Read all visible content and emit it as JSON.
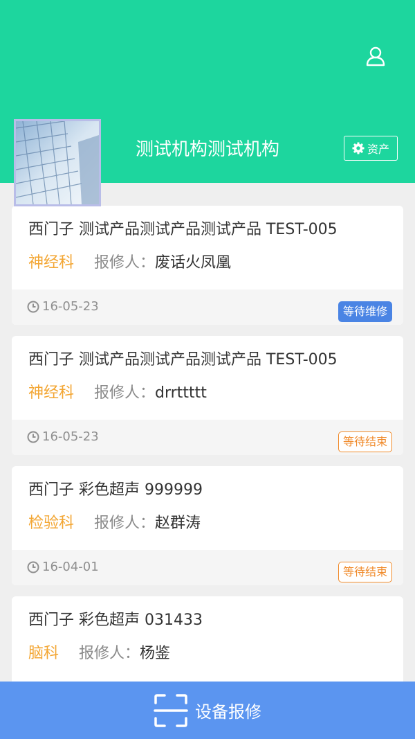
{
  "header": {
    "org_name": "测试机构测试机构",
    "asset_label": "资产",
    "user_icon": "user-icon",
    "settings_icon": "gear-icon"
  },
  "colors": {
    "header_bg": "#1dd69e",
    "department": "#f3a633",
    "badge_repair": "#4a84e4",
    "badge_end": "#f08a2a",
    "bottom_bar": "#5b95f0"
  },
  "orders": [
    {
      "title": "西门子 测试产品测试产品测试产品 TEST-005",
      "department": "神经科",
      "reporter_label": "报修人：",
      "reporter": "废话火凤凰",
      "date": "16-05-23",
      "status": "等待维修"
    },
    {
      "title": "西门子 测试产品测试产品测试产品 TEST-005",
      "department": "神经科",
      "reporter_label": "报修人：",
      "reporter": "drrttttt",
      "date": "16-05-23",
      "status": "等待结束"
    },
    {
      "title": "西门子 彩色超声 999999",
      "department": "检验科",
      "reporter_label": "报修人：",
      "reporter": "赵群涛",
      "date": "16-04-01",
      "status": "等待结束"
    },
    {
      "title": "西门子 彩色超声 031433",
      "department": "脑科",
      "reporter_label": "报修人：",
      "reporter": "杨鉴",
      "date": "",
      "status": ""
    }
  ],
  "bottom": {
    "label": "设备报修",
    "icon": "scan-icon"
  }
}
